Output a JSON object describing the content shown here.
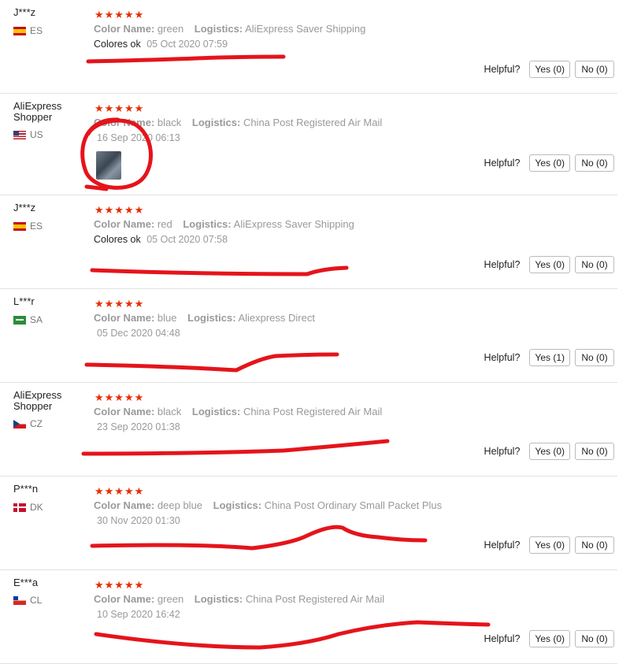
{
  "labels": {
    "color_name": "Color Name:",
    "logistics": "Logistics:",
    "helpful": "Helpful?",
    "stars": "★★★★★"
  },
  "reviews": [
    {
      "user": "J***z",
      "country": "ES",
      "flag": "spain",
      "color": "green",
      "logistics": "AliExpress Saver Shipping",
      "text": "Colores ok",
      "date": "05 Oct 2020 07:59",
      "yes": "Yes (0)",
      "no": "No (0)",
      "rating": 5
    },
    {
      "user": "AliExpress Shopper",
      "country": "US",
      "flag": "usa",
      "color": "black",
      "logistics": "China Post Registered Air Mail",
      "text": "",
      "date": "16 Sep 2020 06:13",
      "yes": "Yes (0)",
      "no": "No (0)",
      "rating": 5,
      "has_photo": true
    },
    {
      "user": "J***z",
      "country": "ES",
      "flag": "spain",
      "color": "red",
      "logistics": "AliExpress Saver Shipping",
      "text": "Colores ok",
      "date": "05 Oct 2020 07:58",
      "yes": "Yes (0)",
      "no": "No (0)",
      "rating": 5
    },
    {
      "user": "L***r",
      "country": "SA",
      "flag": "saudi",
      "color": "blue",
      "logistics": "Aliexpress Direct",
      "text": "",
      "date": "05 Dec 2020 04:48",
      "yes": "Yes (1)",
      "no": "No (0)",
      "rating": 5
    },
    {
      "user": "AliExpress Shopper",
      "country": "CZ",
      "flag": "czech",
      "color": "black",
      "logistics": "China Post Registered Air Mail",
      "text": "",
      "date": "23 Sep 2020 01:38",
      "yes": "Yes (0)",
      "no": "No (0)",
      "rating": 5
    },
    {
      "user": "P***n",
      "country": "DK",
      "flag": "denmark",
      "color": "deep blue",
      "logistics": "China Post Ordinary Small Packet Plus",
      "text": "",
      "date": "30 Nov 2020 01:30",
      "yes": "Yes (0)",
      "no": "No (0)",
      "rating": 5
    },
    {
      "user": "E***a",
      "country": "CL",
      "flag": "chile",
      "color": "green",
      "logistics": "China Post Registered Air Mail",
      "text": "",
      "date": "10 Sep 2020 16:42",
      "yes": "Yes (0)",
      "no": "No (0)",
      "rating": 5
    }
  ],
  "colors": {
    "star": "#e62e04",
    "annotation": "#e5141b"
  }
}
